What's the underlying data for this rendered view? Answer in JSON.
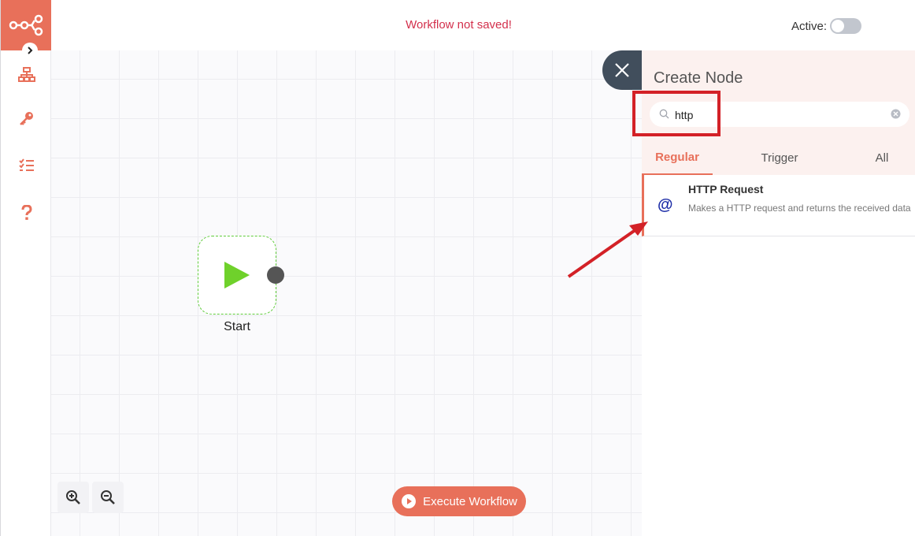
{
  "header": {
    "save_status": "Workflow not saved!",
    "active_label": "Active:",
    "active": false
  },
  "sidebar": {
    "items": [
      {
        "icon": "network-icon"
      },
      {
        "icon": "key-icon"
      },
      {
        "icon": "checklist-icon"
      },
      {
        "icon": "help-icon"
      }
    ]
  },
  "canvas": {
    "start_node_label": "Start",
    "execute_label": "Execute Workflow"
  },
  "create_node": {
    "title": "Create Node",
    "search_value": "http",
    "tabs": [
      {
        "label": "Regular",
        "active": true
      },
      {
        "label": "Trigger",
        "active": false
      },
      {
        "label": "All",
        "active": false
      }
    ],
    "results": [
      {
        "icon": "@",
        "title": "HTTP Request",
        "description": "Makes a HTTP request and returns the received data"
      }
    ]
  },
  "colors": {
    "brand": "#e8705a",
    "unsaved": "#d3304c",
    "start_node": "#5fcc3a",
    "annotation": "#d32127"
  }
}
